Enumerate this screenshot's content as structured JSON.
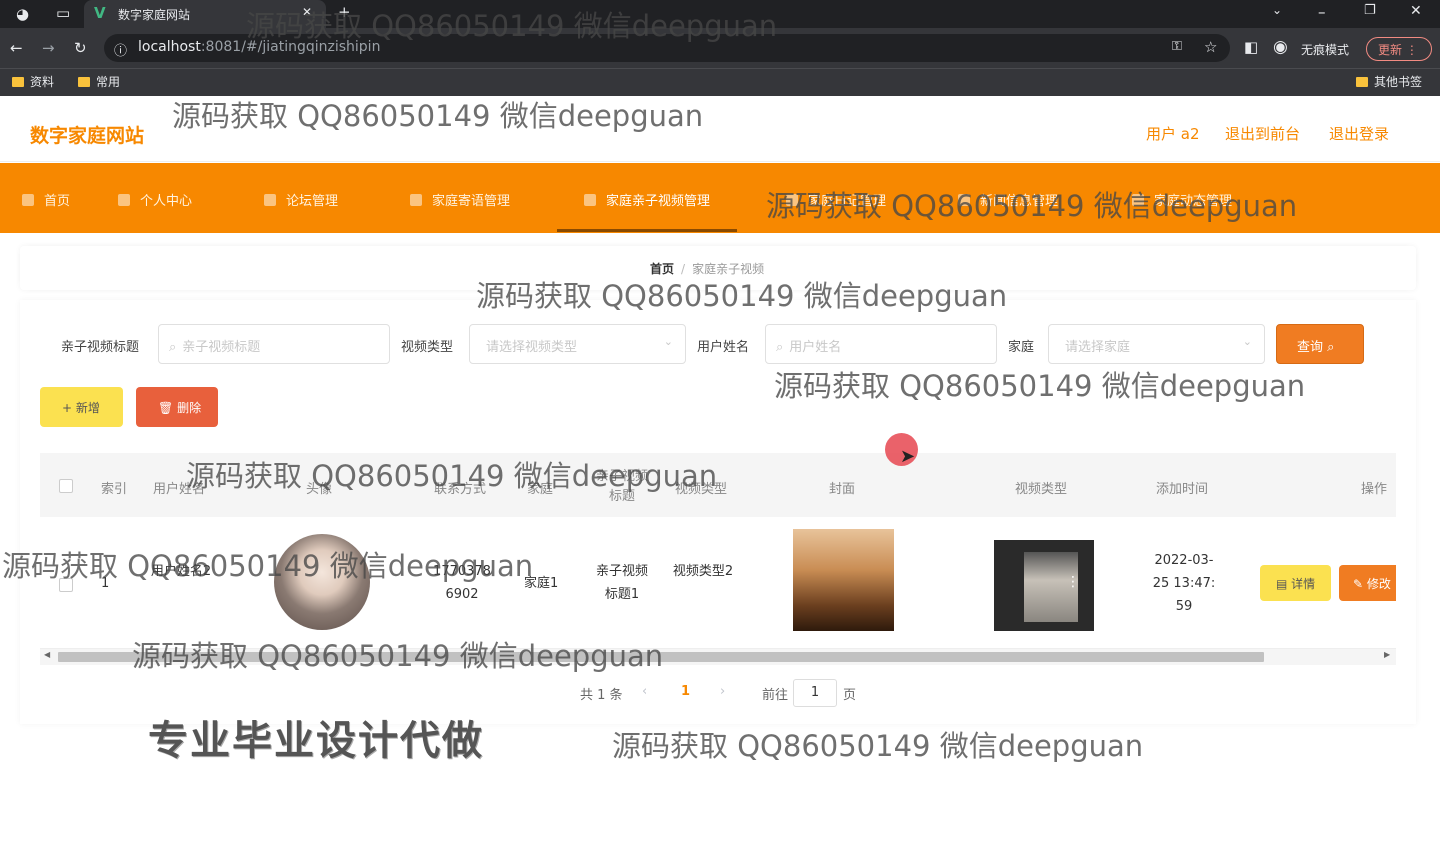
{
  "browser": {
    "tab_title": "数字家庭网站",
    "url_host": "localhost",
    "url_rest": ":8081/#/jiatingqinzishipin",
    "incognito_label": "无痕模式",
    "update_label": "更新",
    "bookmarks": [
      "资料",
      "常用"
    ],
    "other_bookmarks": "其他书签"
  },
  "header": {
    "logo": "数字家庭网站",
    "user": "用户 a2",
    "back_front": "退出到前台",
    "logout": "退出登录"
  },
  "nav": {
    "items": [
      "首页",
      "个人中心",
      "论坛管理",
      "家庭寄语管理",
      "家庭亲子视频管理",
      "家庭日记管理",
      "新闻信息管理",
      "家庭动态管理"
    ],
    "active_index": 4
  },
  "breadcrumb": {
    "home": "首页",
    "separator": "/",
    "current": "家庭亲子视频"
  },
  "filters": {
    "title_label": "亲子视频标题",
    "title_placeholder": "亲子视频标题",
    "type_label": "视频类型",
    "type_placeholder": "请选择视频类型",
    "user_label": "用户姓名",
    "user_placeholder": "用户姓名",
    "family_label": "家庭",
    "family_placeholder": "请选择家庭",
    "search_label": "查询"
  },
  "actions": {
    "add_label": "新增",
    "delete_label": "删除"
  },
  "table": {
    "columns": [
      "索引",
      "用户姓名",
      "头像",
      "联系方式",
      "家庭",
      "亲子视频标题",
      "视频类型",
      "封面",
      "视频类型",
      "添加时间",
      "操作"
    ],
    "rows": [
      {
        "index": "1",
        "user": "用户姓名2",
        "contact": "17703786902",
        "family": "家庭1",
        "title": "亲子视频标题1",
        "type": "视频类型2",
        "time": "2022-03-25 13:47:59",
        "detail": "详情",
        "edit": "修改"
      }
    ]
  },
  "pager": {
    "total": "共 1 条",
    "current_page": "1",
    "goto": "前往",
    "goto_value": "1",
    "page_unit": "页"
  },
  "watermark": "源码获取 QQ86050149 微信deepguan",
  "promo": "专业毕业设计代做",
  "colors": {
    "brand": "#f78800",
    "search": "#f07c22",
    "add": "#fbe150",
    "delete": "#e8603c"
  }
}
